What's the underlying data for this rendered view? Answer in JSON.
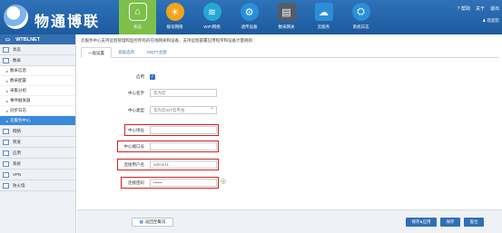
{
  "header": {
    "brand": "物通博联",
    "nav": [
      {
        "label": "状态",
        "icon": "home-icon",
        "color": "#7cc04b"
      },
      {
        "label": "拨号网络",
        "icon": "sun-icon",
        "color": "#f3a21b"
      },
      {
        "label": "WIFI网络",
        "icon": "wifi-icon",
        "color": "#23a9d6"
      },
      {
        "label": "透传设备",
        "icon": "settings-icon",
        "color": "#2a8fd8"
      },
      {
        "label": "数采网关",
        "icon": "server-icon",
        "color": "#555c66"
      },
      {
        "label": "云服务",
        "icon": "cloud-icon",
        "color": "#2a8fd8"
      },
      {
        "label": "系统日志",
        "icon": "network-icon",
        "color": "#2a8fd8"
      }
    ],
    "links": [
      "? 帮助",
      "关于",
      "退出"
    ],
    "user": "欢迎您"
  },
  "sidebar": {
    "title": "WTBLNET",
    "sections_top": [
      "状态",
      "数采"
    ],
    "subs": [
      "数采信息",
      "数采配置",
      "采集分组",
      "事件触发器",
      "同步日志",
      "云服务中心"
    ],
    "active_sub": 5,
    "sections_bottom": [
      "网络",
      "转发",
      "应用",
      "系统",
      "VPN",
      "防火墙"
    ]
  },
  "main": {
    "description": "云服务中心支持远程管理和监控所有的在线网关和设备，支持远程部署应用程序和设备计量规则",
    "tabs": [
      "一般设置",
      "高级选项",
      "MQTT主题"
    ],
    "form": {
      "enable_label": "启用",
      "enable_mark": "✓",
      "center_name_label": "中心名字",
      "center_name_value": "华为云",
      "center_type_label": "中心类型",
      "center_type_value": "华为云IOT云平台",
      "center_addr_label": "中心地址",
      "center_addr_value": "",
      "center_port_label": "中心端口号",
      "center_port_value": "",
      "user_label": "连接用户名",
      "user_value": "admin11",
      "password_label": "连接密码",
      "password_value": "••••••"
    },
    "footer": {
      "overview_label": "返回至概况",
      "save_apply_label": "保存&应用",
      "save_label": "保存",
      "reset_label": "复位"
    }
  }
}
